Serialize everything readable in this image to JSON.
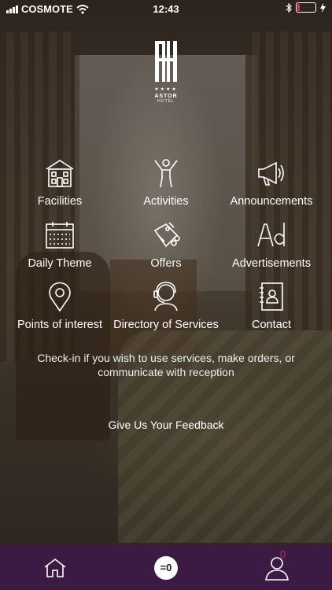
{
  "status_bar": {
    "carrier": "COSMOTE",
    "time": "12:43",
    "battery_color": "#e0323a"
  },
  "logo": {
    "stars": "★★★★",
    "name": "ASTOR",
    "sub": "HOTEL"
  },
  "tiles": [
    {
      "label": "Facilities",
      "icon": "building-icon"
    },
    {
      "label": "Activities",
      "icon": "person-activity-icon"
    },
    {
      "label": "Announcements",
      "icon": "megaphone-icon"
    },
    {
      "label": "Daily Theme",
      "icon": "calendar-icon"
    },
    {
      "label": "Offers",
      "icon": "offers-tag-icon"
    },
    {
      "label": "Advertisements",
      "icon": "ad-icon"
    },
    {
      "label": "Points of interest",
      "icon": "map-pin-icon"
    },
    {
      "label": "Directory of Services",
      "icon": "concierge-headset-icon"
    },
    {
      "label": "Contact",
      "icon": "contact-book-icon"
    }
  ],
  "checkin_text": "Check-in if you wish to use services, make orders, or communicate with reception",
  "feedback_link": "Give Us Your Feedback",
  "tabbar": {
    "key_label": "=0",
    "profile_badge": "0",
    "background": "#3b1a44"
  }
}
